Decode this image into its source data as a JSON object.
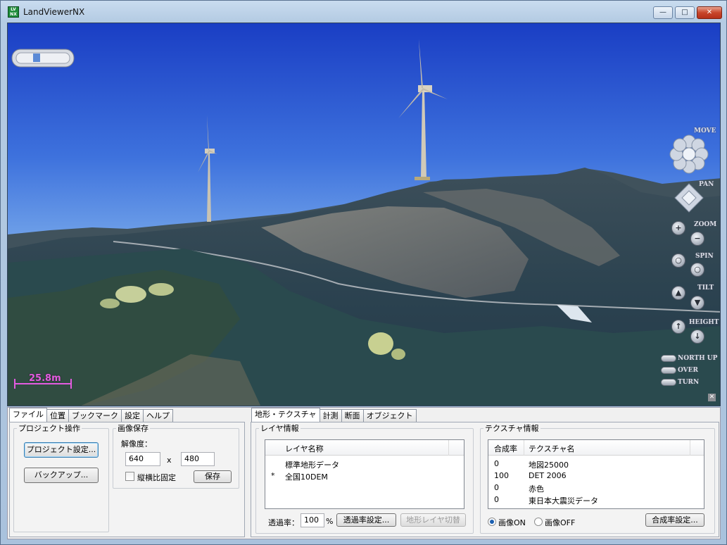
{
  "window": {
    "title": "LandViewerNX",
    "icon_text": "LV NX",
    "minimize": "—",
    "maximize": "□",
    "close": "✕"
  },
  "viewport": {
    "scale_label": "25.8m",
    "nav": {
      "move": "MOVE",
      "pan": "PAN",
      "zoom": "ZOOM",
      "spin": "SPIN",
      "tilt": "TILT",
      "height": "HEIGHT",
      "north_up": "NORTH UP",
      "over": "OVER",
      "turn": "TURN"
    },
    "close_glyph": "✕"
  },
  "left_tabs": [
    "ファイル",
    "位置",
    "ブックマーク",
    "設定",
    "ヘルプ"
  ],
  "project": {
    "legend": "プロジェクト操作",
    "settings_button": "プロジェクト設定...",
    "backup_button": "バックアップ..."
  },
  "image_save": {
    "legend": "画像保存",
    "resolution_label": "解像度：",
    "width": "640",
    "times": "x",
    "height": "480",
    "aspect_lock_label": "縦横比固定",
    "save_button": "保存"
  },
  "right_tabs": [
    "地形・テクスチャ",
    "計測",
    "断面",
    "オブジェクト"
  ],
  "layer_info": {
    "legend": "レイヤ情報",
    "column": "レイヤ名称",
    "rows": [
      {
        "mark": "",
        "name": "標準地形データ"
      },
      {
        "mark": "*",
        "name": "全国10DEM"
      }
    ],
    "opacity_label": "透過率：",
    "opacity_value": "100",
    "percent": "%",
    "opacity_button": "透過率設定...",
    "switch_button": "地形レイヤ切替"
  },
  "texture_info": {
    "legend": "テクスチャ情報",
    "columns": [
      "合成率",
      "テクスチャ名"
    ],
    "rows": [
      {
        "rate": "0",
        "name": "地図25000"
      },
      {
        "rate": "100",
        "name": "DET 2006"
      },
      {
        "rate": "0",
        "name": "赤色"
      },
      {
        "rate": "0",
        "name": "東日本大震災データ"
      }
    ],
    "image_on": "画像ON",
    "image_off": "画像OFF",
    "rate_button": "合成率設定..."
  }
}
